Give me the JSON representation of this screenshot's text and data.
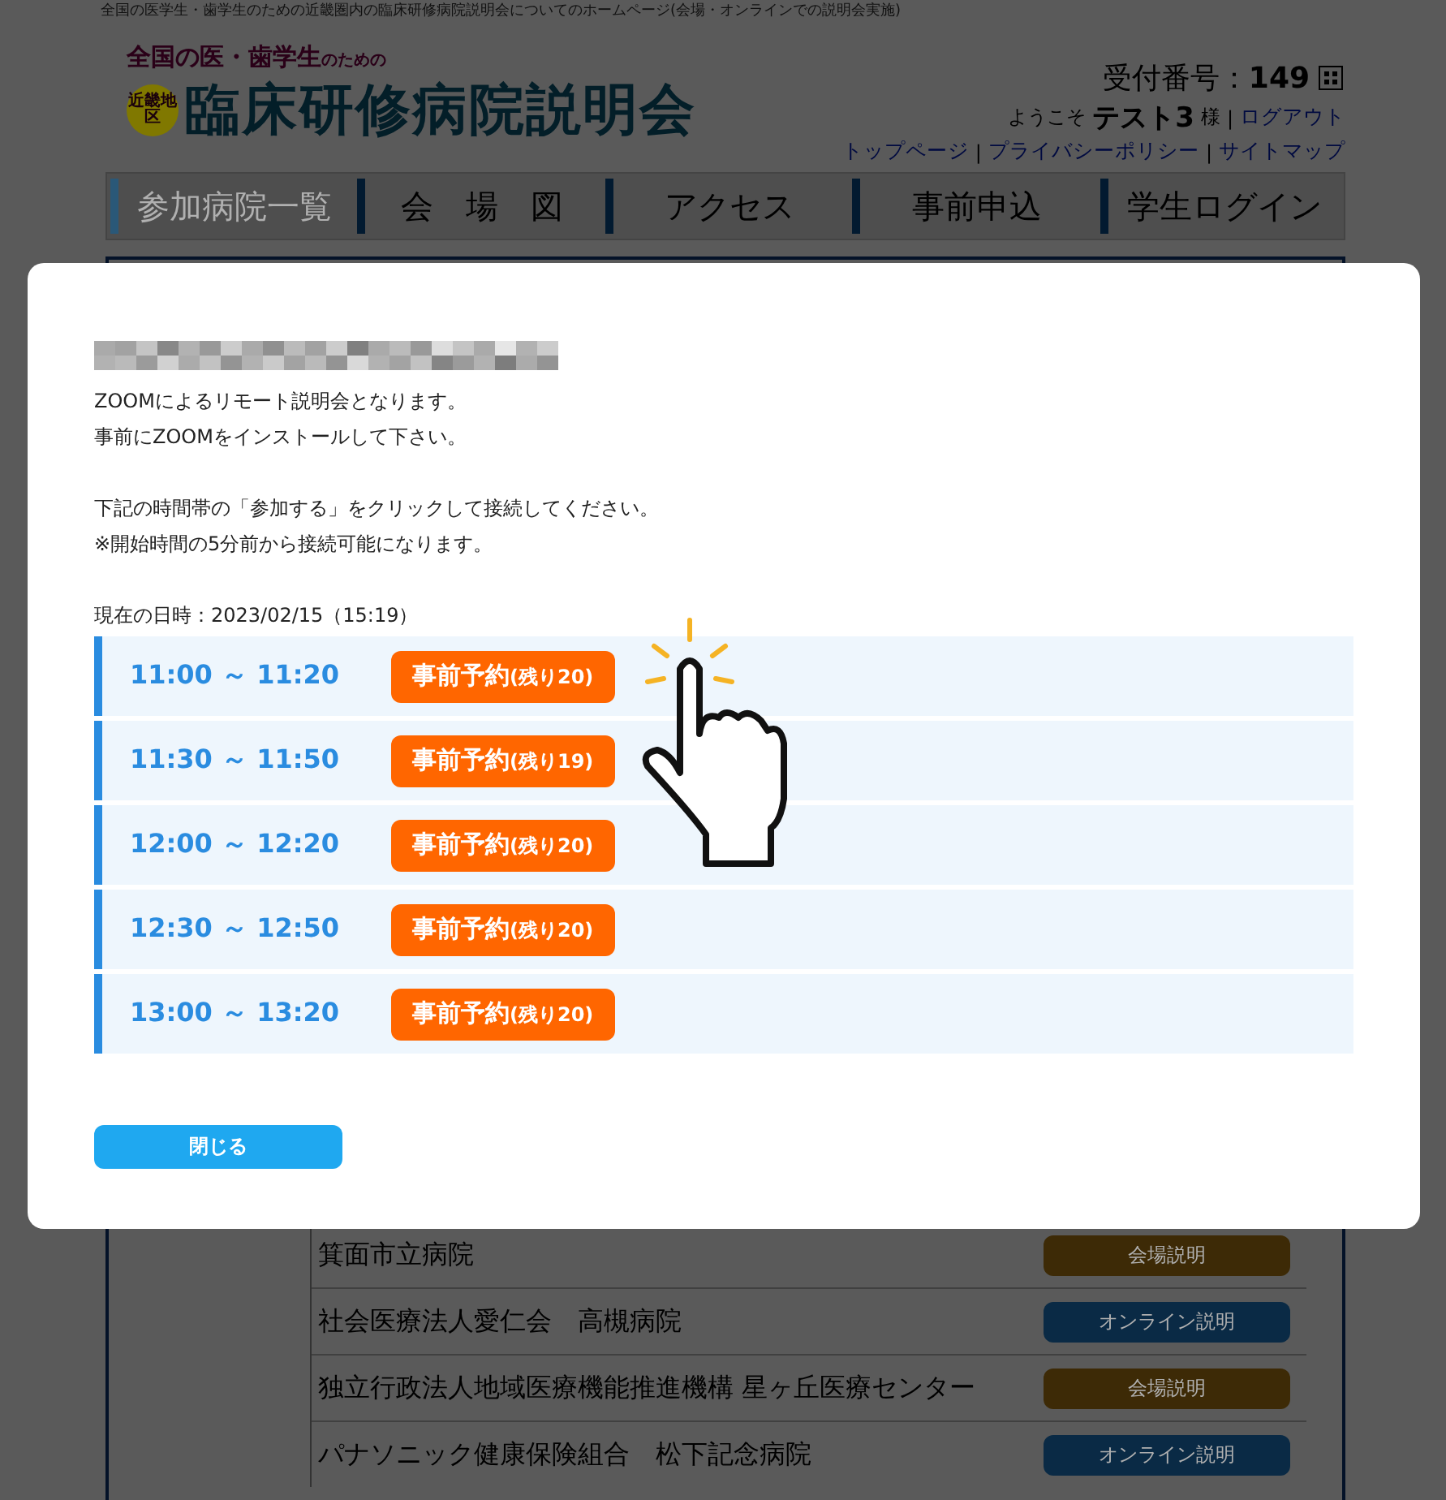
{
  "page": {
    "tagline": "全国の医学生・歯学生のための近畿圏内の臨床研修病院説明会についてのホームページ(会場・オンラインでの説明会実施)",
    "logo": {
      "subtitle": "全国の医・歯学生",
      "subtitle_small": "のための",
      "badge": "近畿地区",
      "title": "臨床研修病院説明会"
    },
    "receipt": {
      "label": "受付番号：",
      "number": "149"
    },
    "welcome": {
      "prefix": "ようこそ",
      "name": "テスト3",
      "suffix": "様",
      "separator": "|",
      "logout": "ログアウト"
    },
    "links": [
      {
        "label": "トップページ"
      },
      {
        "separator": "|",
        "label": "プライバシーポリシー"
      },
      {
        "separator": "|",
        "label": "サイトマップ"
      }
    ],
    "tabs": [
      {
        "label": "参加病院一覧",
        "selected": true
      },
      {
        "label": "会　場　図",
        "selected": false
      },
      {
        "label": "アクセス",
        "selected": false
      },
      {
        "label": "事前申込",
        "selected": false
      },
      {
        "label": "学生ログイン",
        "selected": false
      }
    ],
    "hospitals": [
      {
        "name": "箕面市立病院",
        "tag": "会場説明",
        "color": "#3d2a06"
      },
      {
        "name": "社会医療法人愛仁会　高槻病院",
        "tag": "オンライン説明",
        "color": "#0a2a45"
      },
      {
        "name": "独立行政法人地域医療機能推進機構 星ヶ丘医療センター",
        "tag": "会場説明",
        "color": "#3d2a06"
      },
      {
        "name": "パナソニック健康保険組合　松下記念病院",
        "tag": "オンライン説明",
        "color": "#0a2a45"
      }
    ]
  },
  "modal": {
    "intro": [
      "ZOOMによるリモート説明会となります。",
      "事前にZOOMをインストールして下さい。"
    ],
    "instructions": [
      "下記の時間帯の「参加する」をクリックして接続してください。",
      "※開始時間の5分前から接続可能になります。"
    ],
    "now": "現在の日時：2023/02/15（15:19）",
    "slots": [
      {
        "time": "11:00 ～ 11:20",
        "label": "事前予約",
        "remaining": "(残り20)"
      },
      {
        "time": "11:30 ～ 11:50",
        "label": "事前予約",
        "remaining": "(残り19)"
      },
      {
        "time": "12:00 ～ 12:20",
        "label": "事前予約",
        "remaining": "(残り20)"
      },
      {
        "time": "12:30 ～ 12:50",
        "label": "事前予約",
        "remaining": "(残り20)"
      },
      {
        "time": "13:00 ～ 13:20",
        "label": "事前予約",
        "remaining": "(残り20)"
      }
    ],
    "close": "閉じる"
  }
}
